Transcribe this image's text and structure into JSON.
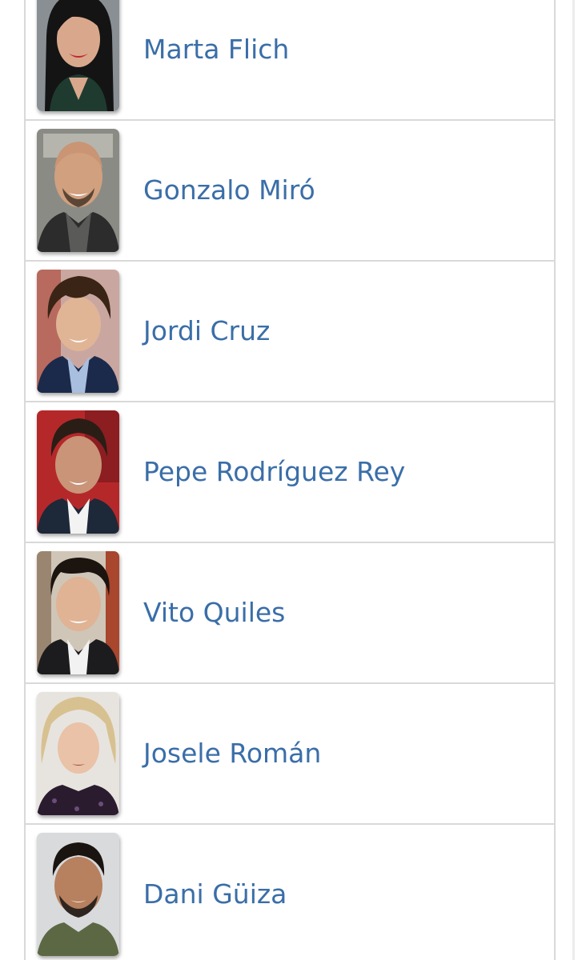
{
  "people": [
    {
      "name": "Marta Flich",
      "photo_alt": "Marta Flich portrait"
    },
    {
      "name": "Gonzalo Miró",
      "photo_alt": "Gonzalo Miró portrait"
    },
    {
      "name": "Jordi Cruz",
      "photo_alt": "Jordi Cruz portrait"
    },
    {
      "name": "Pepe Rodríguez Rey",
      "photo_alt": "Pepe Rodríguez Rey portrait"
    },
    {
      "name": "Vito Quiles",
      "photo_alt": "Vito Quiles portrait"
    },
    {
      "name": "Josele Román",
      "photo_alt": "Josele Román portrait"
    },
    {
      "name": "Dani Güiza",
      "photo_alt": "Dani Güiza portrait"
    }
  ],
  "colors": {
    "link": "#3a6ea8",
    "divider": "#d9d9d9"
  }
}
